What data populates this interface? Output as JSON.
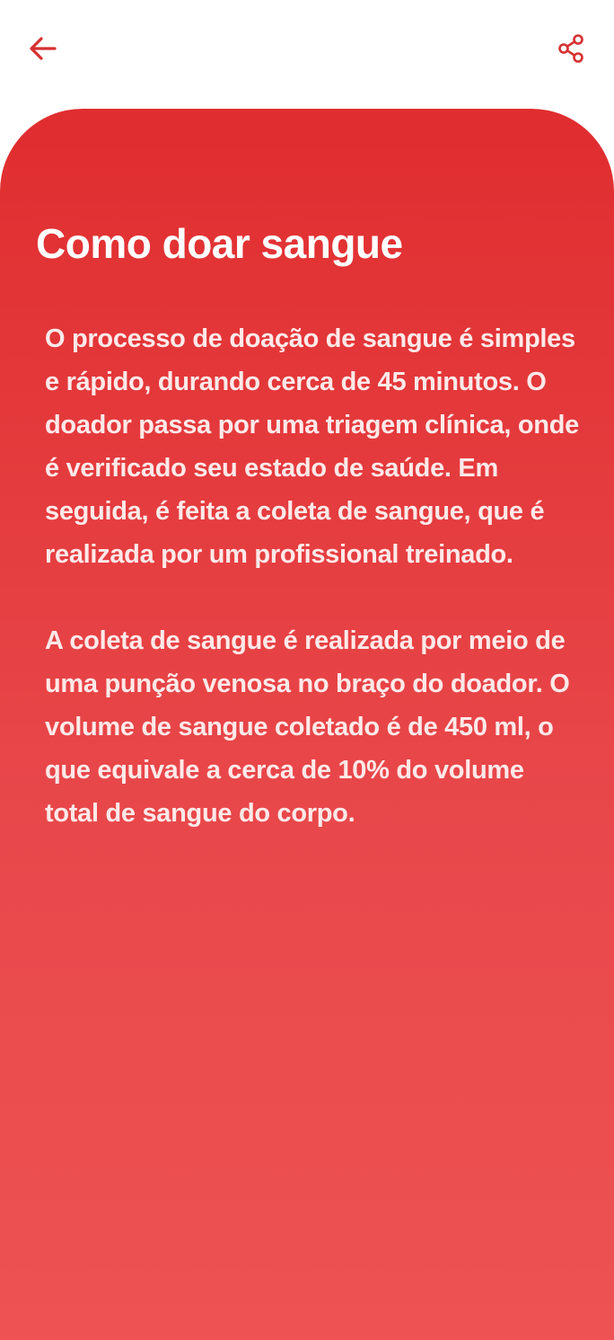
{
  "header": {
    "back_icon": "arrow-left-icon",
    "share_icon": "share-icon",
    "accent_color": "#e02d2f"
  },
  "content": {
    "title": "Como doar sangue",
    "paragraph_1": "O processo de doação de sangue é simples e rápido, durando cerca de 45 minutos. O doador passa por uma triagem clínica, onde é verificado seu estado de saúde. Em seguida, é feita a coleta de sangue, que é realizada por um profissional treinado.",
    "paragraph_2": "A coleta de sangue é realizada por meio de uma punção venosa no braço do doador. O volume de sangue coletado é de 450 ml, o que equivale a cerca de 10% do volume total de sangue do corpo."
  },
  "colors": {
    "card_top": "#e02d2f",
    "card_bottom": "#ee5252",
    "text": "#ffffff"
  }
}
